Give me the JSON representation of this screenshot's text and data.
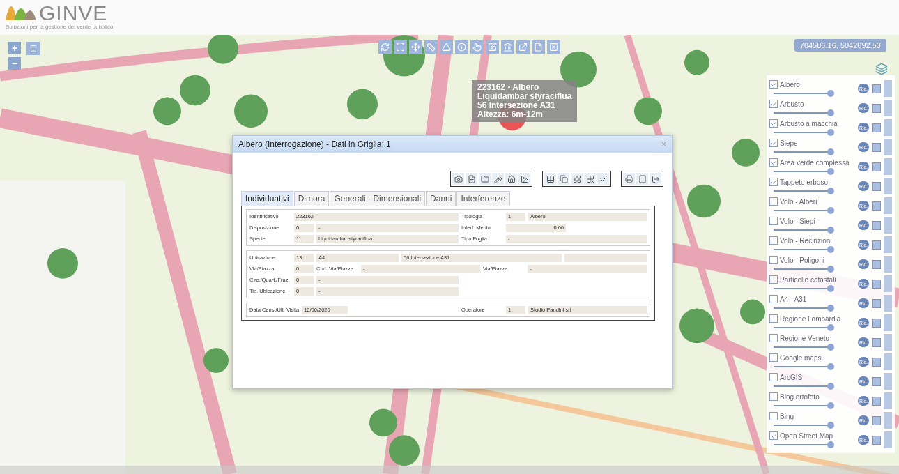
{
  "header": {
    "brand": "GINVE",
    "tagline": "Soluzioni per la gestione del verde pubblico"
  },
  "map_controls": {
    "zoom_in": "+",
    "zoom_out": "−"
  },
  "coordinates": "704586.16, 5042692.53",
  "tooltip": [
    "223162 - Albero",
    "Liquidambar styraciflua",
    "56 Intersezione A31",
    "Altezza: 6m-12m"
  ],
  "dialog": {
    "title": "Albero (Interrogazione) - Dati in Griglia: 1",
    "close": "×",
    "tabs": [
      {
        "label": "Individuativi",
        "selected": true
      },
      {
        "label": "Dimora",
        "selected": false
      },
      {
        "label": "Generali - Dimensionali",
        "selected": false
      },
      {
        "label": "Danni",
        "selected": false
      },
      {
        "label": "Interferenze",
        "selected": false
      }
    ],
    "sections": [
      {
        "rows": [
          {
            "fields": [
              {
                "label": "Identificativo",
                "values": [
                  {
                    "kind": "mid",
                    "text": "223162"
                  }
                ]
              },
              {
                "label": "Tipologia",
                "values": [
                  {
                    "kind": "code",
                    "text": "1"
                  },
                  {
                    "kind": "wide",
                    "text": "Albero"
                  }
                ]
              }
            ]
          },
          {
            "fields": [
              {
                "label": "Disposizione",
                "values": [
                  {
                    "kind": "code",
                    "text": "0"
                  },
                  {
                    "kind": "mid",
                    "text": "-"
                  }
                ]
              },
              {
                "label": "Interf. Medio",
                "values": [
                  {
                    "kind": "number",
                    "text": "0.00"
                  }
                ]
              }
            ]
          },
          {
            "fields": [
              {
                "label": "Specie",
                "values": [
                  {
                    "kind": "code",
                    "text": "11"
                  },
                  {
                    "kind": "wide",
                    "text": "Liquidambar styraciflua"
                  }
                ]
              },
              {
                "label": "Tipo Foglia",
                "values": [
                  {
                    "kind": "mid",
                    "text": "-"
                  }
                ]
              }
            ]
          }
        ]
      },
      {
        "rows": [
          {
            "fields": [
              {
                "label": "Ubicazione",
                "values": [
                  {
                    "kind": "code",
                    "text": "13"
                  },
                  {
                    "kind": "mid",
                    "text": "A4"
                  },
                  {
                    "kind": "wide",
                    "text": "56 Intersezione A31"
                  },
                  {
                    "kind": "blank"
                  }
                ]
              }
            ]
          },
          {
            "fields": [
              {
                "label": "Via/Piazza",
                "values": [
                  {
                    "kind": "code",
                    "text": "0"
                  }
                ]
              },
              {
                "label": "Cod. Via/Piazza",
                "values": [
                  {
                    "kind": "mid",
                    "text": "-"
                  }
                ]
              },
              {
                "label": "Via/Piazza",
                "values": [
                  {
                    "kind": "wide",
                    "text": "-"
                  }
                ]
              }
            ]
          },
          {
            "fields": [
              {
                "label": "Circ./Quart./Fraz.",
                "values": [
                  {
                    "kind": "code",
                    "text": "0"
                  },
                  {
                    "kind": "mid",
                    "text": "-"
                  }
                ]
              }
            ]
          },
          {
            "fields": [
              {
                "label": "Tip. Ubicazione",
                "values": [
                  {
                    "kind": "code",
                    "text": "0"
                  },
                  {
                    "kind": "mid",
                    "text": "-"
                  }
                ]
              }
            ]
          }
        ]
      },
      {
        "rows": [
          {
            "fields": [
              {
                "label": "Data Cens./Ult. Visita",
                "values": [
                  {
                    "kind": "date",
                    "text": "10/06/2020"
                  }
                ]
              },
              {
                "label": "Operatore",
                "values": [
                  {
                    "kind": "code",
                    "text": "1"
                  },
                  {
                    "kind": "wide",
                    "text": "Studio Pandini srl"
                  }
                ]
              }
            ]
          }
        ]
      }
    ]
  },
  "layers": [
    {
      "name": "Albero",
      "checked": true,
      "level": 0.95,
      "refresh": "Ric."
    },
    {
      "name": "Arbusto",
      "checked": true,
      "level": 0.95,
      "refresh": "Ric."
    },
    {
      "name": "Arbusto a macchia",
      "checked": true,
      "level": 0.95,
      "refresh": "Ric."
    },
    {
      "name": "Siepe",
      "checked": true,
      "level": 0.95,
      "refresh": "Ric."
    },
    {
      "name": "Area verde complessa",
      "checked": true,
      "level": 0.95,
      "refresh": "Ric."
    },
    {
      "name": "Tappeto erboso",
      "checked": true,
      "level": 0.95,
      "refresh": "Ric."
    },
    {
      "name": "Volo - Alberi",
      "checked": false,
      "level": 0.95,
      "refresh": "Ric."
    },
    {
      "name": "Volo - Siepi",
      "checked": false,
      "level": 0.95,
      "refresh": "Ric."
    },
    {
      "name": "Volo - Recinzioni",
      "checked": false,
      "level": 0.95,
      "refresh": "Ric."
    },
    {
      "name": "Volo - Poligoni",
      "checked": false,
      "level": 0.95,
      "refresh": "Ric."
    },
    {
      "name": "Particelle catastali",
      "checked": false,
      "level": 0.95,
      "refresh": "Ric."
    },
    {
      "name": "A4 - A31",
      "checked": false,
      "level": 0.95,
      "refresh": "Ric."
    },
    {
      "name": "Regione Lombardia",
      "checked": false,
      "level": 0.95,
      "refresh": "Ric."
    },
    {
      "name": "Regione Veneto",
      "checked": false,
      "level": 0.95,
      "refresh": "Ric."
    },
    {
      "name": "Google maps",
      "checked": false,
      "level": 0.95,
      "refresh": "Ric."
    },
    {
      "name": "ArcGIS",
      "checked": false,
      "level": 0.95,
      "refresh": "Ric."
    },
    {
      "name": "Bing ortofoto",
      "checked": false,
      "level": 0.95,
      "refresh": "Ric."
    },
    {
      "name": "Bing",
      "checked": false,
      "level": 0.95,
      "refresh": "Ric."
    },
    {
      "name": "Open Street Map",
      "checked": true,
      "level": 0.95,
      "refresh": "Ric."
    }
  ]
}
